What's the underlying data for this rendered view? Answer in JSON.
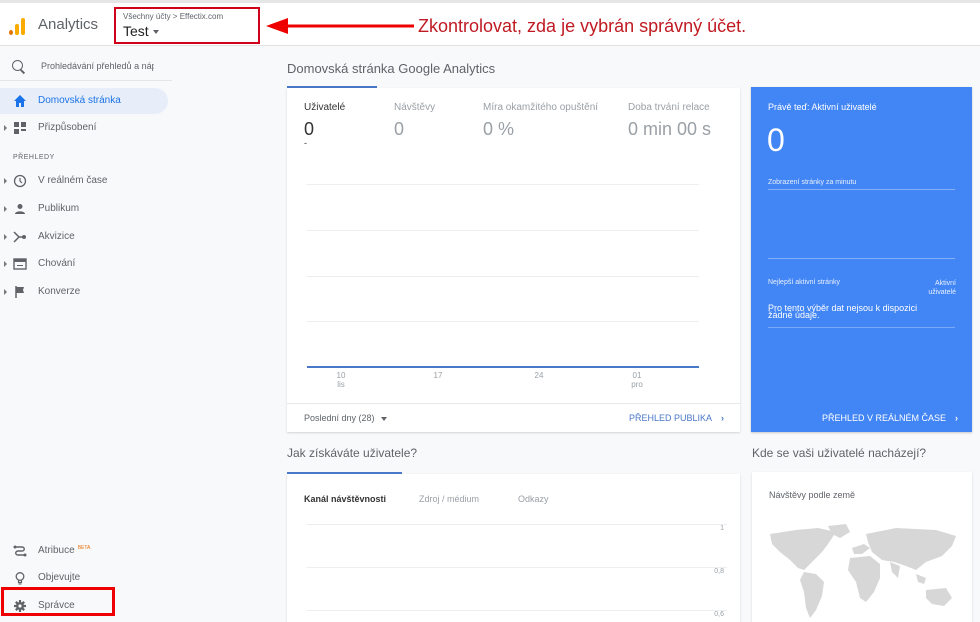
{
  "header": {
    "app_name": "Analytics",
    "breadcrumb": "Všechny účty > Effectix.com",
    "view_name": "Test",
    "annotation": "Zkontrolovat, zda je vybrán správný účet."
  },
  "sidebar": {
    "search_placeholder": "Prohledávání přehledů a náp",
    "items": [
      {
        "label": "Domovská stránka",
        "icon": "home-icon"
      },
      {
        "label": "Přizpůsobení",
        "icon": "dashboard-icon"
      }
    ],
    "section_label": "PŘEHLEDY",
    "reports": [
      {
        "label": "V reálném čase",
        "icon": "clock-icon"
      },
      {
        "label": "Publikum",
        "icon": "person-icon"
      },
      {
        "label": "Akvizice",
        "icon": "acquisition-icon"
      },
      {
        "label": "Chování",
        "icon": "behavior-icon"
      },
      {
        "label": "Konverze",
        "icon": "flag-icon"
      }
    ],
    "bottom": [
      {
        "label": "Atribuce",
        "badge": "BETA",
        "icon": "attribution-icon"
      },
      {
        "label": "Objevujte",
        "icon": "lightbulb-icon"
      },
      {
        "label": "Správce",
        "icon": "gear-icon"
      }
    ]
  },
  "main": {
    "title": "Domovská stránka Google Analytics",
    "metrics": [
      {
        "label": "Uživatelé",
        "value": "0",
        "sub": "-"
      },
      {
        "label": "Návštěvy",
        "value": "0"
      },
      {
        "label": "Míra okamžitého opuštění",
        "value": "0 %"
      },
      {
        "label": "Doba trvání relace",
        "value": "0 min 00 s"
      }
    ],
    "date_range": "Poslední dny (28)",
    "audience_link": "PŘEHLED PUBLIKA"
  },
  "realtime": {
    "title": "Právě teď: Aktivní uživatelé",
    "value": "0",
    "pageviews_label": "Zobrazení stránky za minutu",
    "top_pages_label": "Nejlepší aktivní stránky",
    "active_users_label_1": "Aktivní",
    "active_users_label_2": "uživatelé",
    "empty_line1": "Pro tento výběr dat nejsou k dispozici",
    "empty_line2": "žádné údaje.",
    "link": "PŘEHLED V REÁLNÉM ČASE"
  },
  "acquisition": {
    "title": "Jak získáváte uživatele?",
    "tabs": [
      "Kanál návštěvnosti",
      "Zdroj / médium",
      "Odkazy"
    ]
  },
  "geo": {
    "title": "Kde se vaši uživatelé nacházejí?",
    "label": "Návštěvy podle země"
  },
  "chart_data": [
    {
      "type": "line",
      "title": "Uživatelé",
      "x": [
        "10 lis",
        "17",
        "24",
        "01 pro"
      ],
      "x_ticks": [
        {
          "day": "10",
          "month": "lis"
        },
        {
          "day": "17",
          "month": ""
        },
        {
          "day": "24",
          "month": ""
        },
        {
          "day": "01",
          "month": "pro"
        }
      ],
      "series": [
        {
          "name": "Uživatelé",
          "values": [
            0,
            0,
            0,
            0
          ]
        }
      ],
      "ylim": [
        0,
        1
      ],
      "grid": true
    },
    {
      "type": "line",
      "title": "Kanál návštěvnosti",
      "y_ticks": [
        "1",
        "0,8",
        "0,6"
      ],
      "grid": true
    }
  ]
}
